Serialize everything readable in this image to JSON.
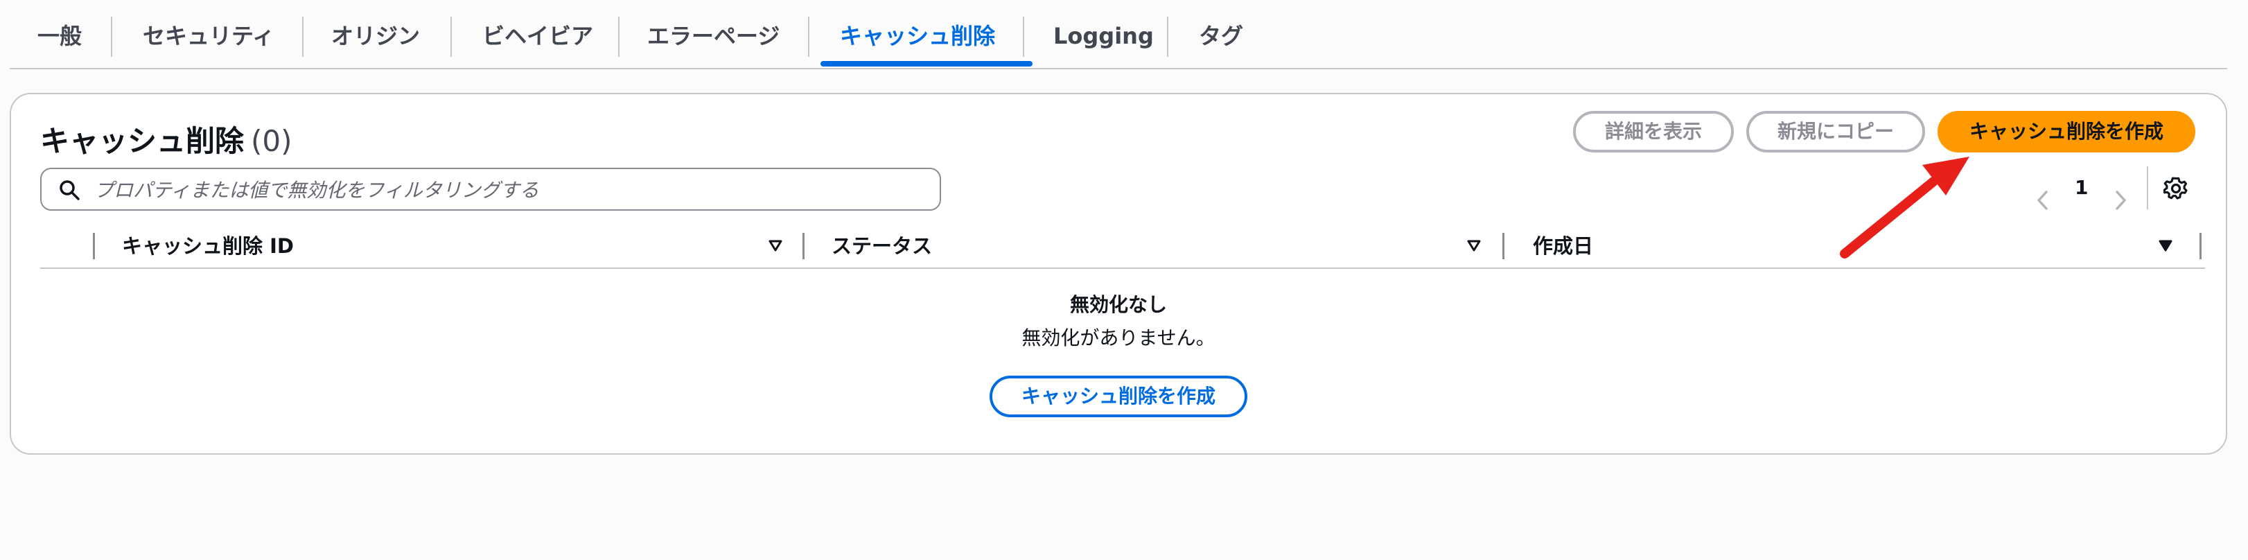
{
  "tabs": [
    {
      "label": "一般"
    },
    {
      "label": "セキュリティ"
    },
    {
      "label": "オリジン"
    },
    {
      "label": "ビヘイビア"
    },
    {
      "label": "エラーページ"
    },
    {
      "label": "キャッシュ削除",
      "active": true
    },
    {
      "label": "Logging"
    },
    {
      "label": "タグ"
    }
  ],
  "panel": {
    "title": "キャッシュ削除",
    "count": "(0)",
    "view_details_label": "詳細を表示",
    "copy_new_label": "新規にコピー",
    "create_label": "キャッシュ削除を作成"
  },
  "search": {
    "placeholder": "プロパティまたは値で無効化をフィルタリングする",
    "icon": "search-icon"
  },
  "pagination": {
    "current_page": "1"
  },
  "table": {
    "columns": [
      "キャッシュ削除 ID",
      "ステータス",
      "作成日"
    ],
    "rows": []
  },
  "empty_state": {
    "title": "無効化なし",
    "description": "無効化がありません。",
    "button_label": "キャッシュ削除を作成"
  },
  "colors": {
    "accent": "#006ce0",
    "primary_button": "#ff9900",
    "annotation_arrow": "#e8201a"
  }
}
